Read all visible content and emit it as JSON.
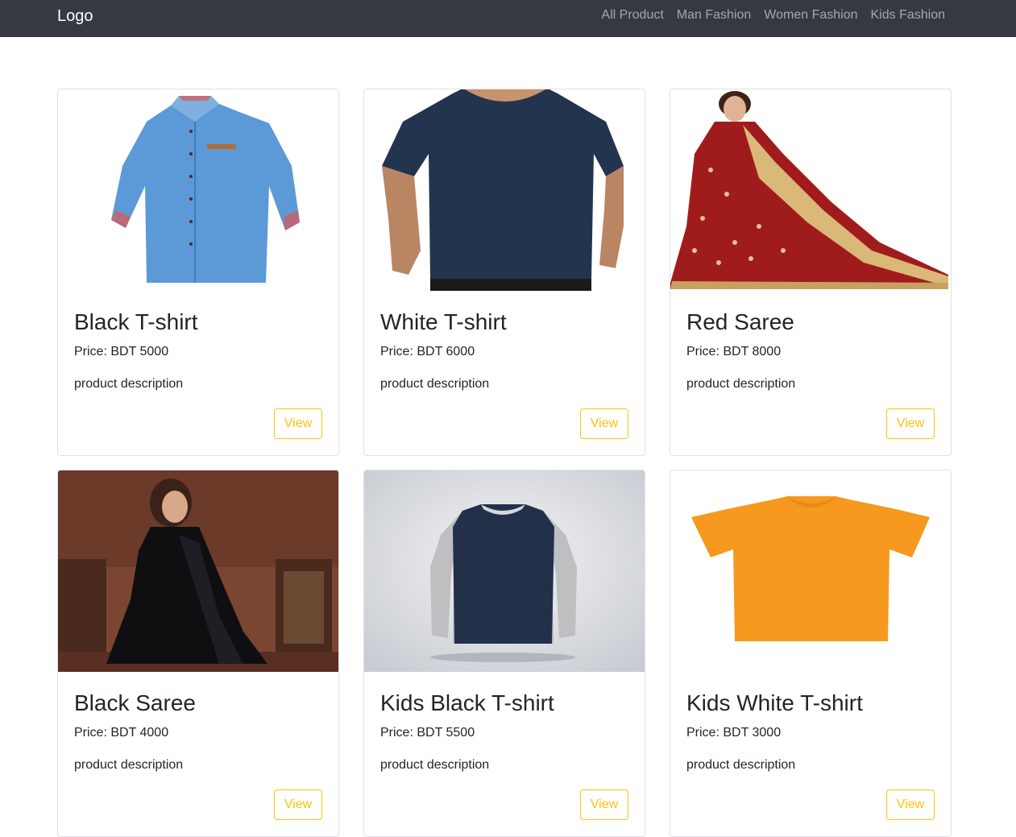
{
  "navbar": {
    "brand": "Logo",
    "links": [
      "All Product",
      "Man Fashion",
      "Women Fashion",
      "Kids Fashion"
    ]
  },
  "products": [
    {
      "title": "Black T-shirt",
      "price": "Price: BDT 5000",
      "description": "product description",
      "button": "View",
      "image": "blue-shirt-image"
    },
    {
      "title": "White T-shirt",
      "price": "Price: BDT 6000",
      "description": "product description",
      "button": "View",
      "image": "navy-tshirt-image"
    },
    {
      "title": "Red Saree",
      "price": "Price: BDT 8000",
      "description": "product description",
      "button": "View",
      "image": "red-saree-image"
    },
    {
      "title": "Black Saree",
      "price": "Price: BDT 4000",
      "description": "product description",
      "button": "View",
      "image": "black-saree-image"
    },
    {
      "title": "Kids Black T-shirt",
      "price": "Price: BDT 5500",
      "description": "product description",
      "button": "View",
      "image": "raglan-longsleeve-image"
    },
    {
      "title": "Kids White T-shirt",
      "price": "Price: BDT 3000",
      "description": "product description",
      "button": "View",
      "image": "orange-tshirt-image"
    }
  ],
  "colors": {
    "navbar_bg": "#343a40",
    "button_outline": "#ffc107",
    "card_border": "#dee2e6"
  }
}
